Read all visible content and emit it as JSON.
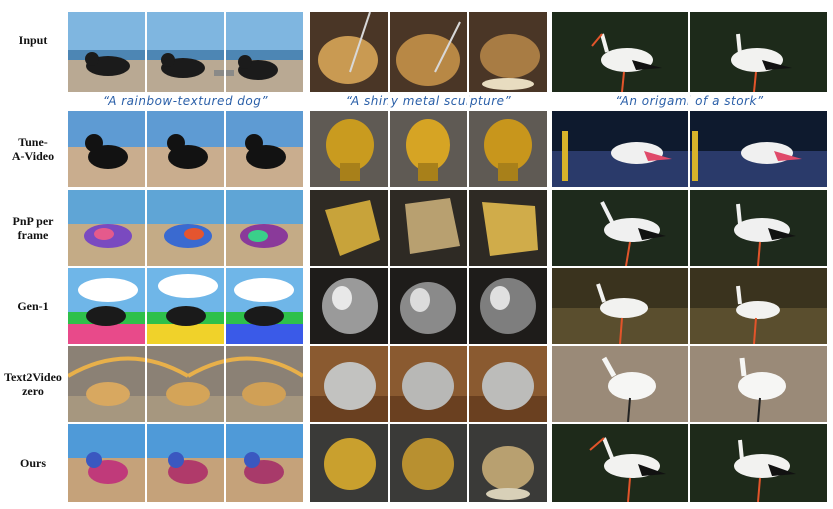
{
  "rows": [
    {
      "label": "Input"
    },
    {
      "label": "Tune-\nA-Video"
    },
    {
      "label": "PnP per\nframe"
    },
    {
      "label": "Gen-1"
    },
    {
      "label": "Text2Video\nzero"
    },
    {
      "label": "Ours"
    }
  ],
  "captions": [
    "“A rainbow-textured dog”",
    "“A shiny metal sculpture”",
    "“An origami of a stork”"
  ]
}
